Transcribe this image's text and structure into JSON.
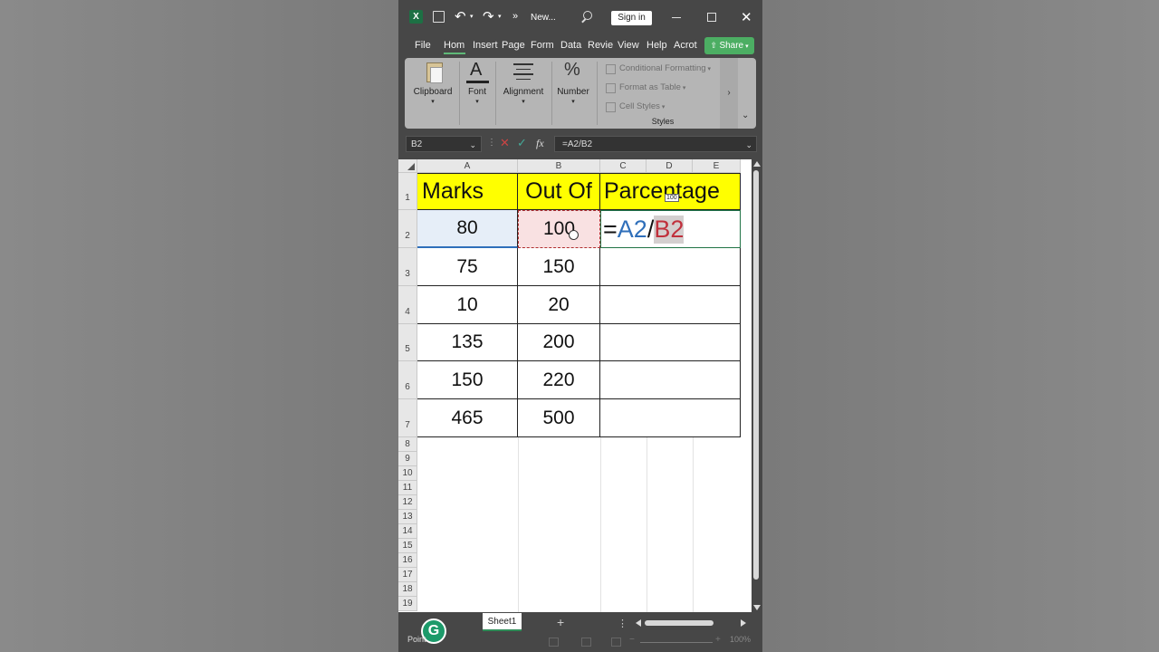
{
  "titlebar": {
    "filename": "New...",
    "signin_label": "Sign in",
    "more_label": "»"
  },
  "tabs": [
    "File",
    "Hom",
    "Insert",
    "Page",
    "Form",
    "Data",
    "Revie",
    "View",
    "Help",
    "Acrot"
  ],
  "share_label": "Share",
  "ribbon": {
    "clipboard": "Clipboard",
    "font": "Font",
    "alignment": "Alignment",
    "number": "Number",
    "conditional_formatting": "Conditional Formatting",
    "format_as_table": "Format as Table",
    "cell_styles": "Cell Styles",
    "styles_group": "Styles"
  },
  "formula_bar": {
    "name_box": "B2",
    "formula": "=A2/B2",
    "fx": "fx"
  },
  "columns": [
    "A",
    "B",
    "C",
    "D",
    "E"
  ],
  "rows": [
    "1",
    "2",
    "3",
    "4",
    "5",
    "6",
    "7",
    "8",
    "9",
    "10",
    "11",
    "12",
    "13",
    "14",
    "15",
    "16",
    "17",
    "18",
    "19"
  ],
  "table": {
    "headers": [
      "Marks",
      "Out Of",
      "Parcentage"
    ],
    "data": [
      [
        "80",
        "100"
      ],
      [
        "75",
        "150"
      ],
      [
        "10",
        "20"
      ],
      [
        "135",
        "200"
      ],
      [
        "150",
        "220"
      ],
      [
        "465",
        "500"
      ]
    ],
    "editing_formula": {
      "eq": "=",
      "a": "A2",
      "slash": "/",
      "b": "B2"
    },
    "tooltip": "100"
  },
  "sheet_tab": "Sheet1",
  "add_sheet": "+",
  "status": {
    "mode": "Point",
    "zoom": "100%"
  },
  "colors": {
    "accent_green": "#4cae63",
    "header_yellow": "#ffff00",
    "ref_blue": "#2f6fba",
    "ref_red": "#c0303c"
  }
}
